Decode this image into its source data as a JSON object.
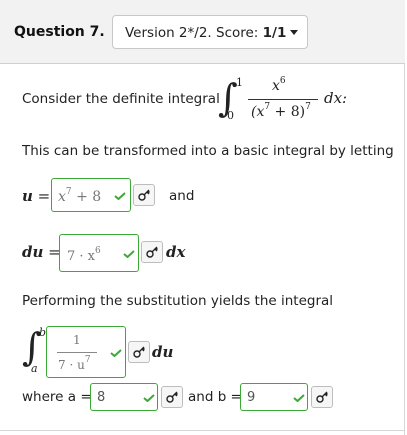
{
  "header": {
    "question_title": "Question 7.",
    "version_prefix": "Version 2*/2. Score: ",
    "version_score": "1/1"
  },
  "problem": {
    "intro": "Consider the definite integral",
    "integral_lower": "0",
    "integral_upper": "1",
    "integrand_num": "x",
    "integrand_num_exp": "6",
    "integrand_den": "(x",
    "integrand_den_inner_exp": "7",
    "integrand_den_tail": " + 8)",
    "integrand_den_exp": "7",
    "differential": "dx:",
    "transform_text": "This can be transformed into a basic integral by letting",
    "u_label": "u",
    "u_answer_base": "x",
    "u_answer_exp": "7",
    "u_answer_tail": " + 8",
    "and_text": "and",
    "du_label": "du",
    "du_answer_base": "7 · x",
    "du_answer_exp": "6",
    "du_suffix": "dx",
    "substitution_text": "Performing the substitution yields the integral",
    "sub_lower": "a",
    "sub_upper": "b",
    "sub_num": "1",
    "sub_den_base": "7 · u",
    "sub_den_exp": "7",
    "sub_suffix": "du",
    "where_a_text": "where a =",
    "a_value": "8",
    "and_b_text": "and b =",
    "b_value": "9"
  },
  "icons": [
    "chevron-down-icon",
    "check-icon",
    "key-icon"
  ],
  "colors": {
    "correct": "#3aaa35",
    "header_bg": "#f2f2f2"
  }
}
